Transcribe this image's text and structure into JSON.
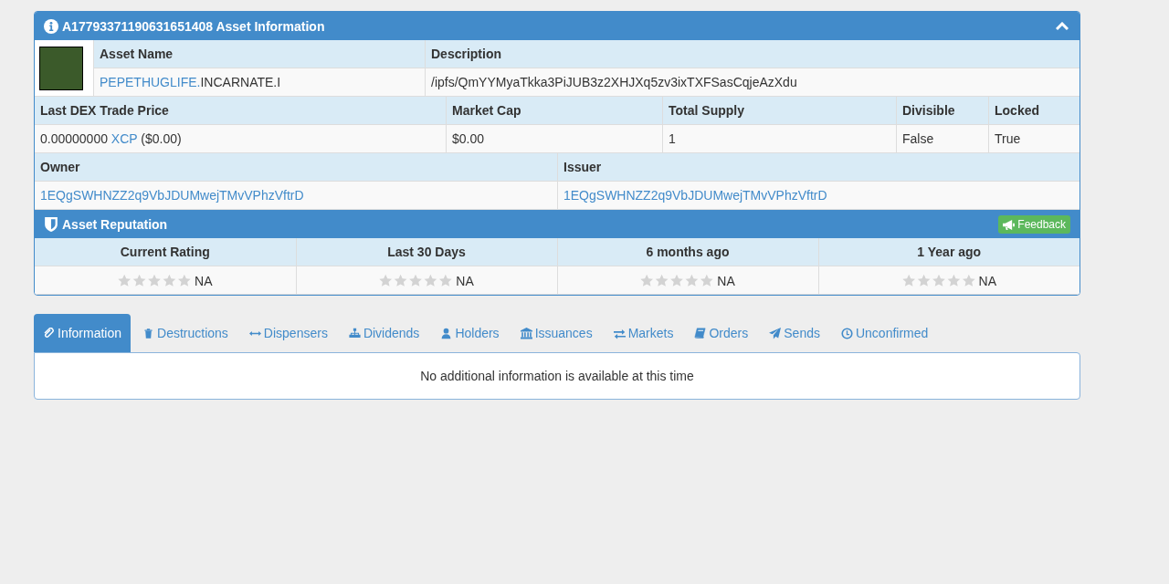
{
  "panel": {
    "title": "A17793371190631651408 Asset Information",
    "collapsed": false
  },
  "asset": {
    "name_label": "Asset Name",
    "description_label": "Description",
    "parent_link": "PEPETHUGLIFE.",
    "subname": "INCARNATE.I",
    "description": "/ipfs/QmYYMyaTkka3PiJUB3z2XHJXq5zv3ixTXFSasCqjeAzXdu"
  },
  "market": {
    "columns": [
      "Last DEX Trade Price",
      "Market Cap",
      "Total Supply",
      "Divisible",
      "Locked"
    ],
    "price": "0.00000000",
    "price_unit": "XCP",
    "price_usd": "($0.00)",
    "cells": [
      "$0.00",
      "1",
      "False",
      "True"
    ]
  },
  "parties": {
    "columns": [
      "Owner",
      "Issuer"
    ],
    "values": [
      "1EQgSWHNZZ2q9VbJDUMwejTMvVPhzVftrD",
      "1EQgSWHNZZ2q9VbJDUMwejTMvVPhzVftrD"
    ]
  },
  "reputation": {
    "title": "Asset Reputation",
    "feedback_button": "Feedback",
    "ratings": [
      {
        "label": "Current Rating",
        "stars": 0,
        "value": "NA"
      },
      {
        "label": "Last 30 Days",
        "stars": 0,
        "value": "NA"
      },
      {
        "label": "6 months ago",
        "stars": 0,
        "value": "NA"
      },
      {
        "label": "1 Year ago",
        "stars": 0,
        "value": "NA"
      }
    ]
  },
  "tabs": [
    {
      "label": "Information",
      "selected": true
    },
    {
      "label": "Destructions",
      "selected": false
    },
    {
      "label": "Dispensers",
      "selected": false
    },
    {
      "label": "Dividends",
      "selected": false
    },
    {
      "label": "Holders",
      "selected": false
    },
    {
      "label": "Issuances",
      "selected": false
    },
    {
      "label": "Markets",
      "selected": false
    },
    {
      "label": "Orders",
      "selected": false
    },
    {
      "label": "Sends",
      "selected": false
    },
    {
      "label": "Unconfirmed",
      "selected": false
    }
  ],
  "tab_content": "No additional information is available at this time"
}
